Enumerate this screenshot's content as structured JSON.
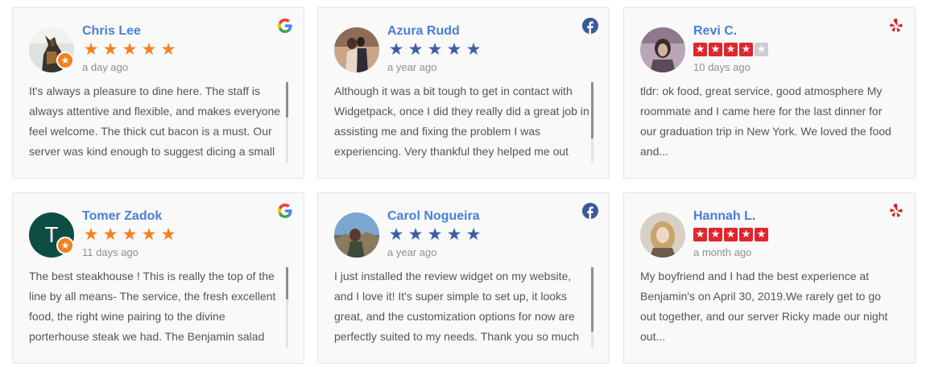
{
  "reviews": [
    {
      "name": "Chris Lee",
      "source": "google",
      "source_icon": "google-icon",
      "rating": 5,
      "date": "a day ago",
      "text": "It's always a pleasure to dine here. The staff is always attentive and flexible, and makes everyone feel welcome. The thick cut bacon is a must. Our server was kind enough to suggest dicing a small",
      "avatar": "photo",
      "badge": "★"
    },
    {
      "name": "Azura Rudd",
      "source": "facebook",
      "source_icon": "facebook-icon",
      "rating": 5,
      "date": "a year ago",
      "text": "Although it was a bit tough to get in contact with Widgetpack, once I did they really did a great job in assisting me and fixing the problem I was experiencing. Very thankful they helped me out",
      "avatar": "photo"
    },
    {
      "name": "Revi C.",
      "source": "yelp",
      "source_icon": "yelp-icon",
      "rating": 4,
      "date": "10 days ago",
      "text": "tldr: ok food, great service, good atmosphere My roommate and I came here for the last dinner for our graduation trip in New York. We loved the food and...",
      "avatar": "photo"
    },
    {
      "name": "Tomer Zadok",
      "source": "google",
      "source_icon": "google-icon",
      "rating": 5,
      "date": "11 days ago",
      "text": "The best steakhouse ! This is really the top of the line by all means- The service, the fresh excellent food, the right wine pairing to the divine porterhouse steak we had. The Benjamin salad",
      "avatar": "initial",
      "initial": "T",
      "badge": "★"
    },
    {
      "name": "Carol Nogueira",
      "source": "facebook",
      "source_icon": "facebook-icon",
      "rating": 5,
      "date": "a year ago",
      "text": "I just installed the review widget on my website, and I love it! It's super simple to set up, it looks great, and the customization options for now are perfectly suited to my needs. Thank you so much",
      "avatar": "photo"
    },
    {
      "name": "Hannah L.",
      "source": "yelp",
      "source_icon": "yelp-icon",
      "rating": 5,
      "date": "a month ago",
      "text": "My boyfriend and I had the best experience at Benjamin's on April 30, 2019.We rarely get to go out together, and our server Ricky made our night out...",
      "avatar": "photo"
    }
  ],
  "colors": {
    "name": "#4a7ed8",
    "google_star": "#f2811f",
    "facebook_star": "#3b5da8",
    "yelp_star": "#e0262c",
    "yelp_star_empty": "#cccccc",
    "badge": "#f2811f",
    "initial_avatar": "#0e4d43"
  }
}
